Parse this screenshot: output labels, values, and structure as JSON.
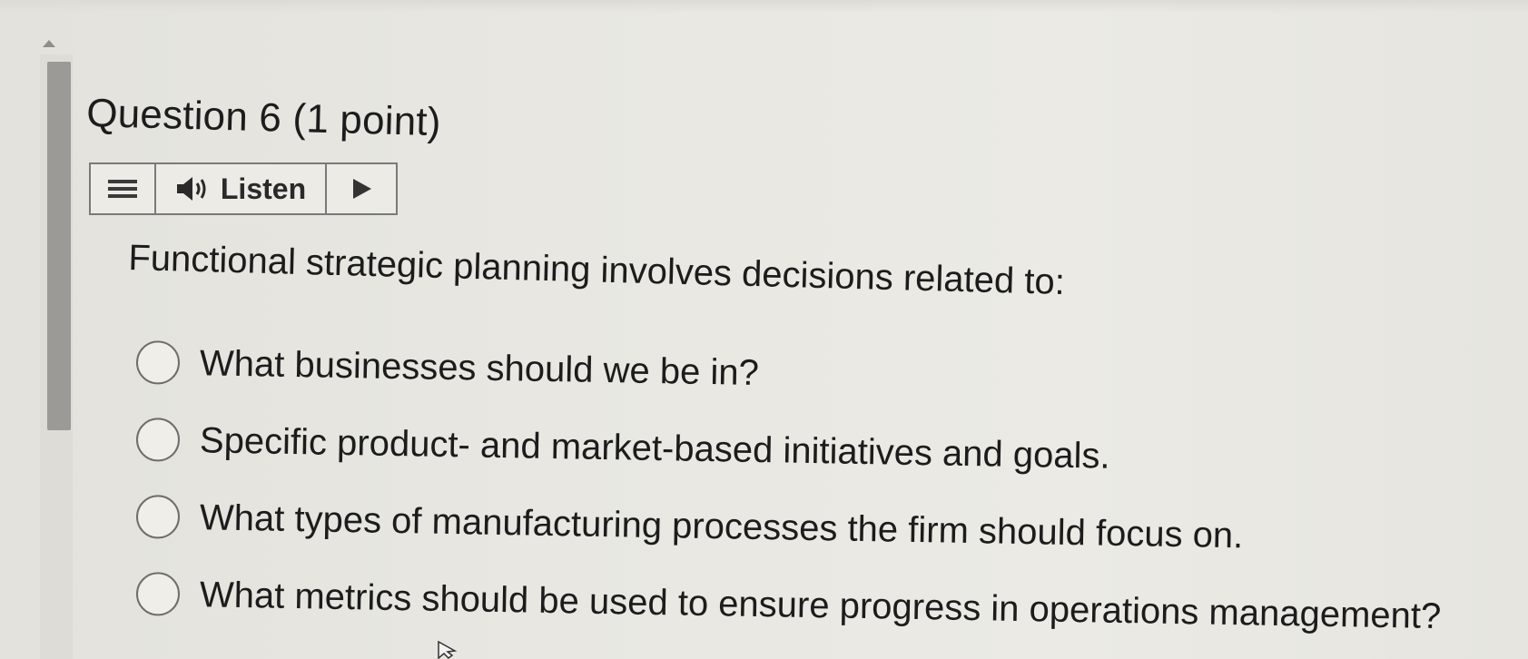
{
  "question": {
    "title": "Question 6 (1 point)",
    "prompt": "Functional strategic planning involves decisions related to:"
  },
  "toolbar": {
    "menu_icon": "hamburger-menu-icon",
    "speaker_icon": "speaker-icon",
    "listen_label": "Listen",
    "play_icon": "play-icon"
  },
  "options": [
    {
      "label": "What businesses should we be in?",
      "selected": false
    },
    {
      "label": "Specific product- and market-based initiatives and goals.",
      "selected": false
    },
    {
      "label": "What types of manufacturing processes the firm should focus on.",
      "selected": false
    },
    {
      "label": "What metrics should be used to ensure progress in operations management?",
      "selected": false
    }
  ],
  "colors": {
    "background": "#e8e7e1",
    "text": "#1c1c1c",
    "border": "#7a7a7a",
    "scrollbar_thumb": "#9b9a96"
  }
}
